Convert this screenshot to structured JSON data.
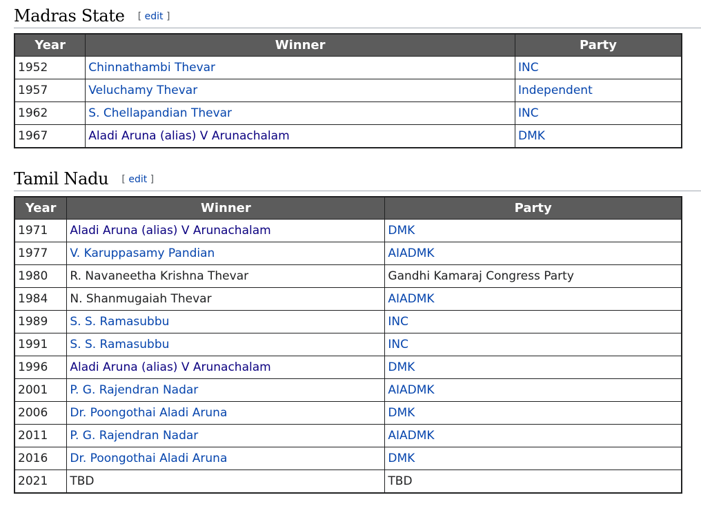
{
  "sections": [
    {
      "title": "Madras State",
      "edit_label": "edit",
      "headers": [
        "Year",
        "Winner",
        "Party"
      ],
      "rows": [
        {
          "year": "1952",
          "winner": "Chinnathambi Thevar",
          "winner_link": true,
          "party": "INC",
          "party_link": true
        },
        {
          "year": "1957",
          "winner": "Veluchamy Thevar",
          "winner_link": true,
          "party": "Independent",
          "party_link": true
        },
        {
          "year": "1962",
          "winner": "S. Chellapandian Thevar",
          "winner_link": true,
          "party": "INC",
          "party_link": true
        },
        {
          "year": "1967",
          "winner": "Aladi Aruna (alias) V Arunachalam",
          "winner_link": true,
          "winner_visited": true,
          "party": "DMK",
          "party_link": true
        }
      ]
    },
    {
      "title": "Tamil Nadu",
      "edit_label": "edit",
      "headers": [
        "Year",
        "Winner",
        "Party"
      ],
      "rows": [
        {
          "year": "1971",
          "winner": "Aladi Aruna (alias) V Arunachalam",
          "winner_link": true,
          "winner_visited": true,
          "party": "DMK",
          "party_link": true
        },
        {
          "year": "1977",
          "winner": "V. Karuppasamy Pandian",
          "winner_link": true,
          "party": "AIADMK",
          "party_link": true
        },
        {
          "year": "1980",
          "winner": "R. Navaneetha Krishna Thevar",
          "winner_link": false,
          "party": "Gandhi Kamaraj Congress Party",
          "party_link": false
        },
        {
          "year": "1984",
          "winner": "N. Shanmugaiah Thevar",
          "winner_link": false,
          "party": "AIADMK",
          "party_link": true
        },
        {
          "year": "1989",
          "winner": "S. S. Ramasubbu",
          "winner_link": true,
          "party": "INC",
          "party_link": true
        },
        {
          "year": "1991",
          "winner": "S. S. Ramasubbu",
          "winner_link": true,
          "party": "INC",
          "party_link": true
        },
        {
          "year": "1996",
          "winner": "Aladi Aruna (alias) V Arunachalam",
          "winner_link": true,
          "winner_visited": true,
          "party": "DMK",
          "party_link": true
        },
        {
          "year": "2001",
          "winner": "P. G. Rajendran Nadar",
          "winner_link": true,
          "party": "AIADMK",
          "party_link": true
        },
        {
          "year": "2006",
          "winner": "Dr. Poongothai Aladi Aruna",
          "winner_link": true,
          "party": "DMK",
          "party_link": true
        },
        {
          "year": "2011",
          "winner": "P. G. Rajendran Nadar",
          "winner_link": true,
          "party": "AIADMK",
          "party_link": true
        },
        {
          "year": "2016",
          "winner": "Dr. Poongothai Aladi Aruna",
          "winner_link": true,
          "party": "DMK",
          "party_link": true
        },
        {
          "year": "2021",
          "winner": "TBD",
          "winner_link": false,
          "party": "TBD",
          "party_link": false
        }
      ]
    }
  ]
}
